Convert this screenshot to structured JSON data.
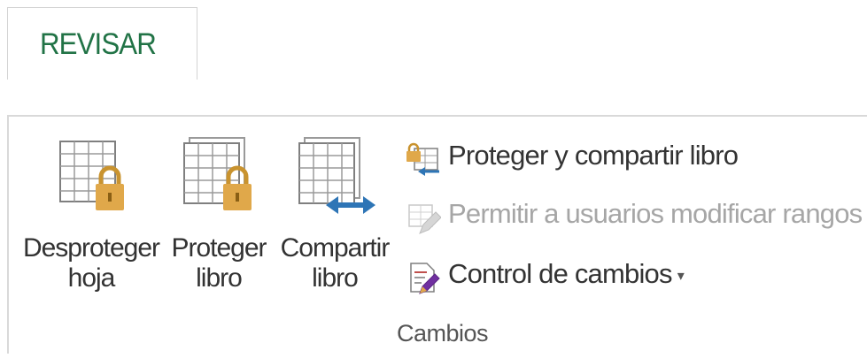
{
  "tab": {
    "label": "REVISAR"
  },
  "group": {
    "label": "Cambios",
    "large_buttons": [
      {
        "line1": "Desproteger",
        "line2": "hoja",
        "icon": "unprotect-sheet-icon"
      },
      {
        "line1": "Proteger",
        "line2": "libro",
        "icon": "protect-workbook-icon"
      },
      {
        "line1": "Compartir",
        "line2": "libro",
        "icon": "share-workbook-icon"
      }
    ],
    "small_buttons": [
      {
        "label": "Proteger y compartir libro",
        "icon": "protect-share-icon",
        "enabled": true
      },
      {
        "label": "Permitir a usuarios modificar rangos",
        "icon": "allow-edit-ranges-icon",
        "enabled": false
      },
      {
        "label": "Control de cambios",
        "icon": "track-changes-icon",
        "enabled": true,
        "dropdown": true
      }
    ]
  },
  "colors": {
    "tab_text": "#217346",
    "lock": "#e0a84a",
    "arrow": "#2e75b6"
  }
}
